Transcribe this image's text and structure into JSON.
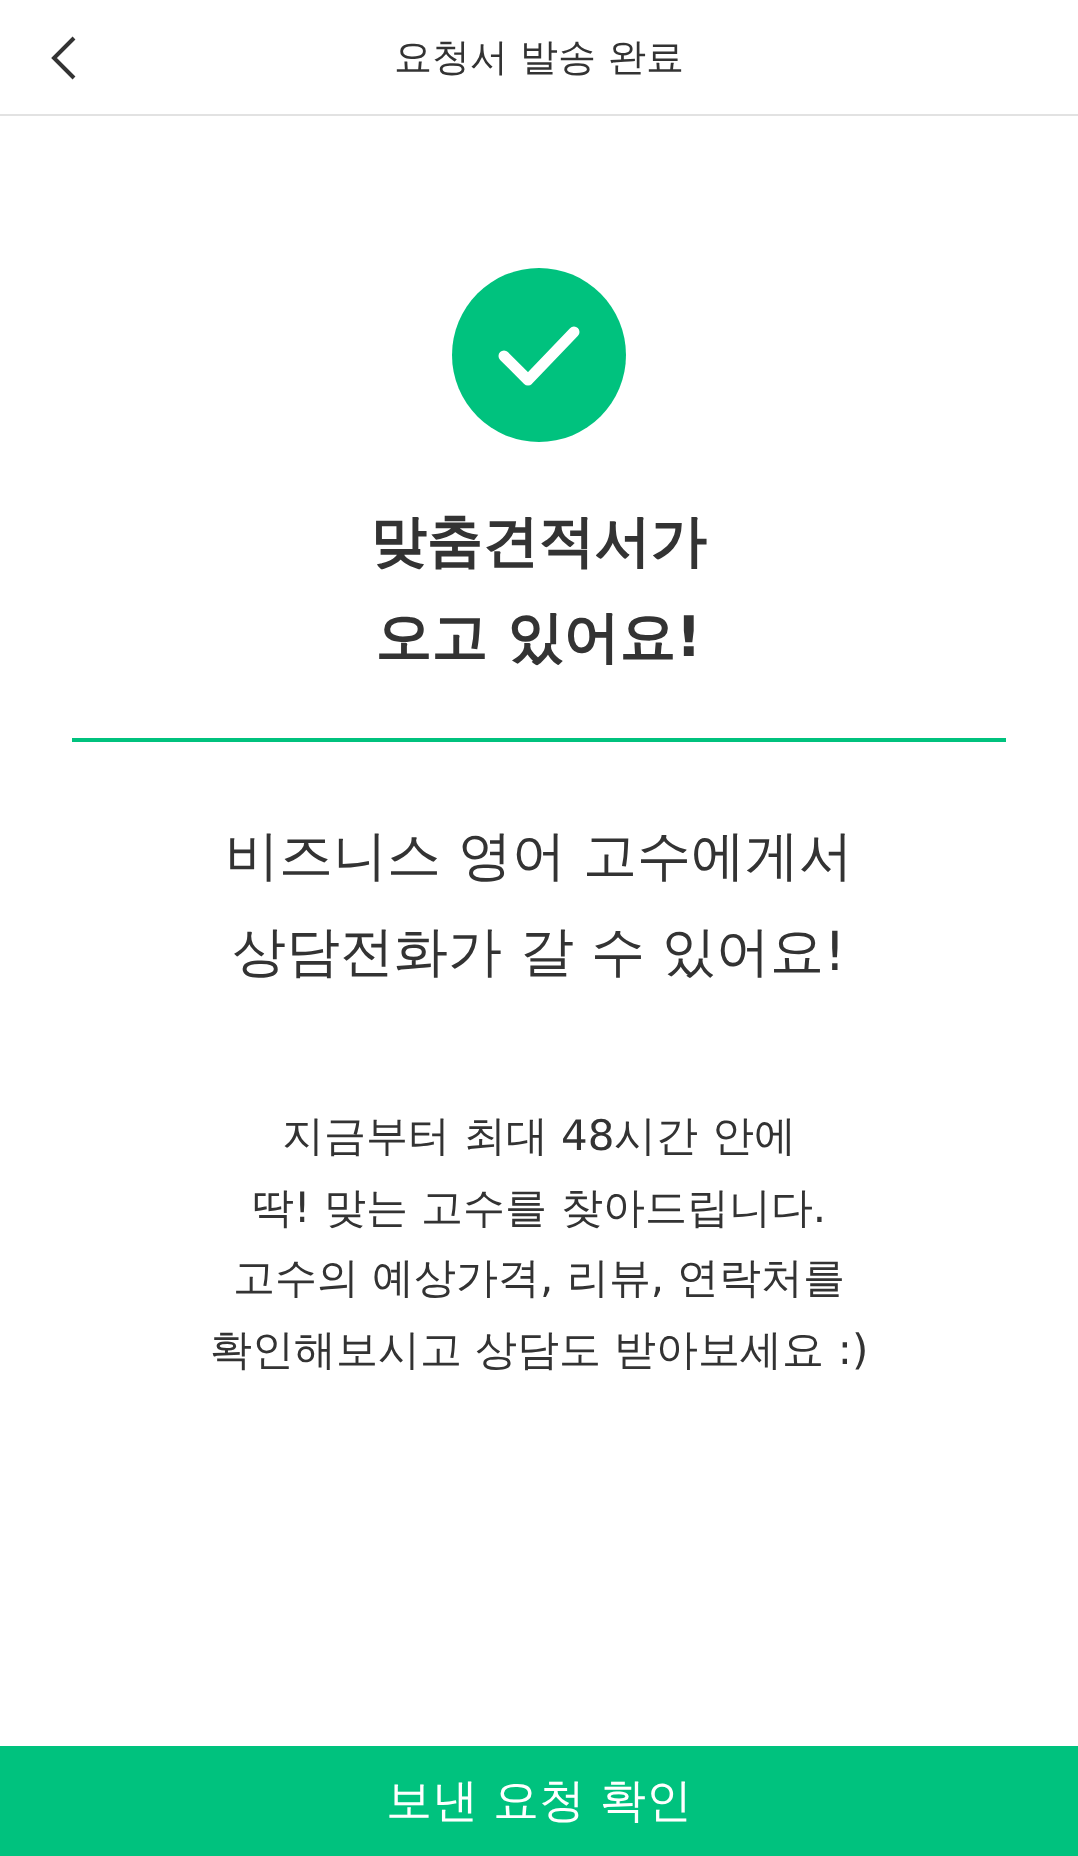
{
  "header": {
    "title": "요청서 발송 완료"
  },
  "headline": [
    "맞춤견적서가",
    "오고 있어요!"
  ],
  "subtitle": [
    "비즈니스 영어 고수에게서",
    "상담전화가 갈 수 있어요!"
  ],
  "body": [
    "지금부터 최대 48시간 안에",
    "딱! 맞는 고수를 찾아드립니다.",
    "고수의 예상가격, 리뷰, 연락처를",
    "확인해보시고 상담도 받아보세요 :)"
  ],
  "button": {
    "label": "보낸 요청 확인"
  }
}
